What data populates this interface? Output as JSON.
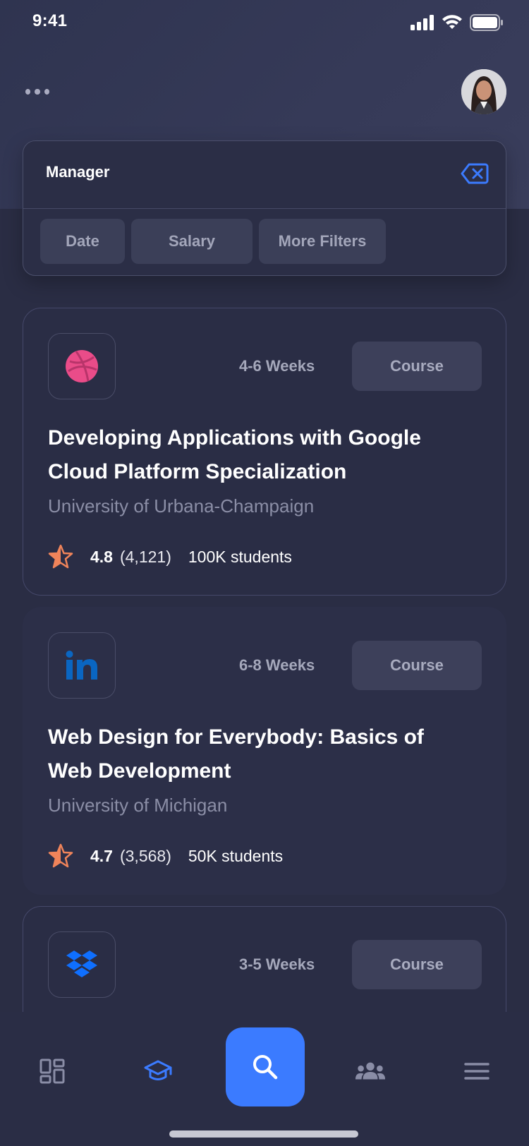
{
  "status_bar": {
    "time": "9:41"
  },
  "search": {
    "value": "Manager"
  },
  "filters": [
    {
      "label": "Date"
    },
    {
      "label": "Salary"
    },
    {
      "label": "More Filters"
    }
  ],
  "courses": [
    {
      "logo": "dribbble-icon",
      "duration": "4-6 Weeks",
      "type": "Course",
      "title": "Developing Applications with Google Cloud Platform Specialization",
      "university": "University of Urbana-Champaign",
      "rating": "4.8",
      "reviews": "(4,121)",
      "students": "100K students"
    },
    {
      "logo": "linkedin-icon",
      "duration": "6-8 Weeks",
      "type": "Course",
      "title": "Web Design for Everybody: Basics of Web Development",
      "university": "University of Michigan",
      "rating": "4.7",
      "reviews": "(3,568)",
      "students": "50K students"
    },
    {
      "logo": "dropbox-icon",
      "duration": "3-5 Weeks",
      "type": "Course"
    }
  ],
  "bottom_nav": [
    {
      "icon": "dashboard-icon"
    },
    {
      "icon": "graduation-cap-icon",
      "active": true
    },
    {
      "icon": "search-icon",
      "highlighted": true
    },
    {
      "icon": "people-icon"
    },
    {
      "icon": "menu-icon"
    }
  ],
  "colors": {
    "accent": "#3b7bff",
    "star": "#f0845a",
    "background": "#2a2d44"
  }
}
